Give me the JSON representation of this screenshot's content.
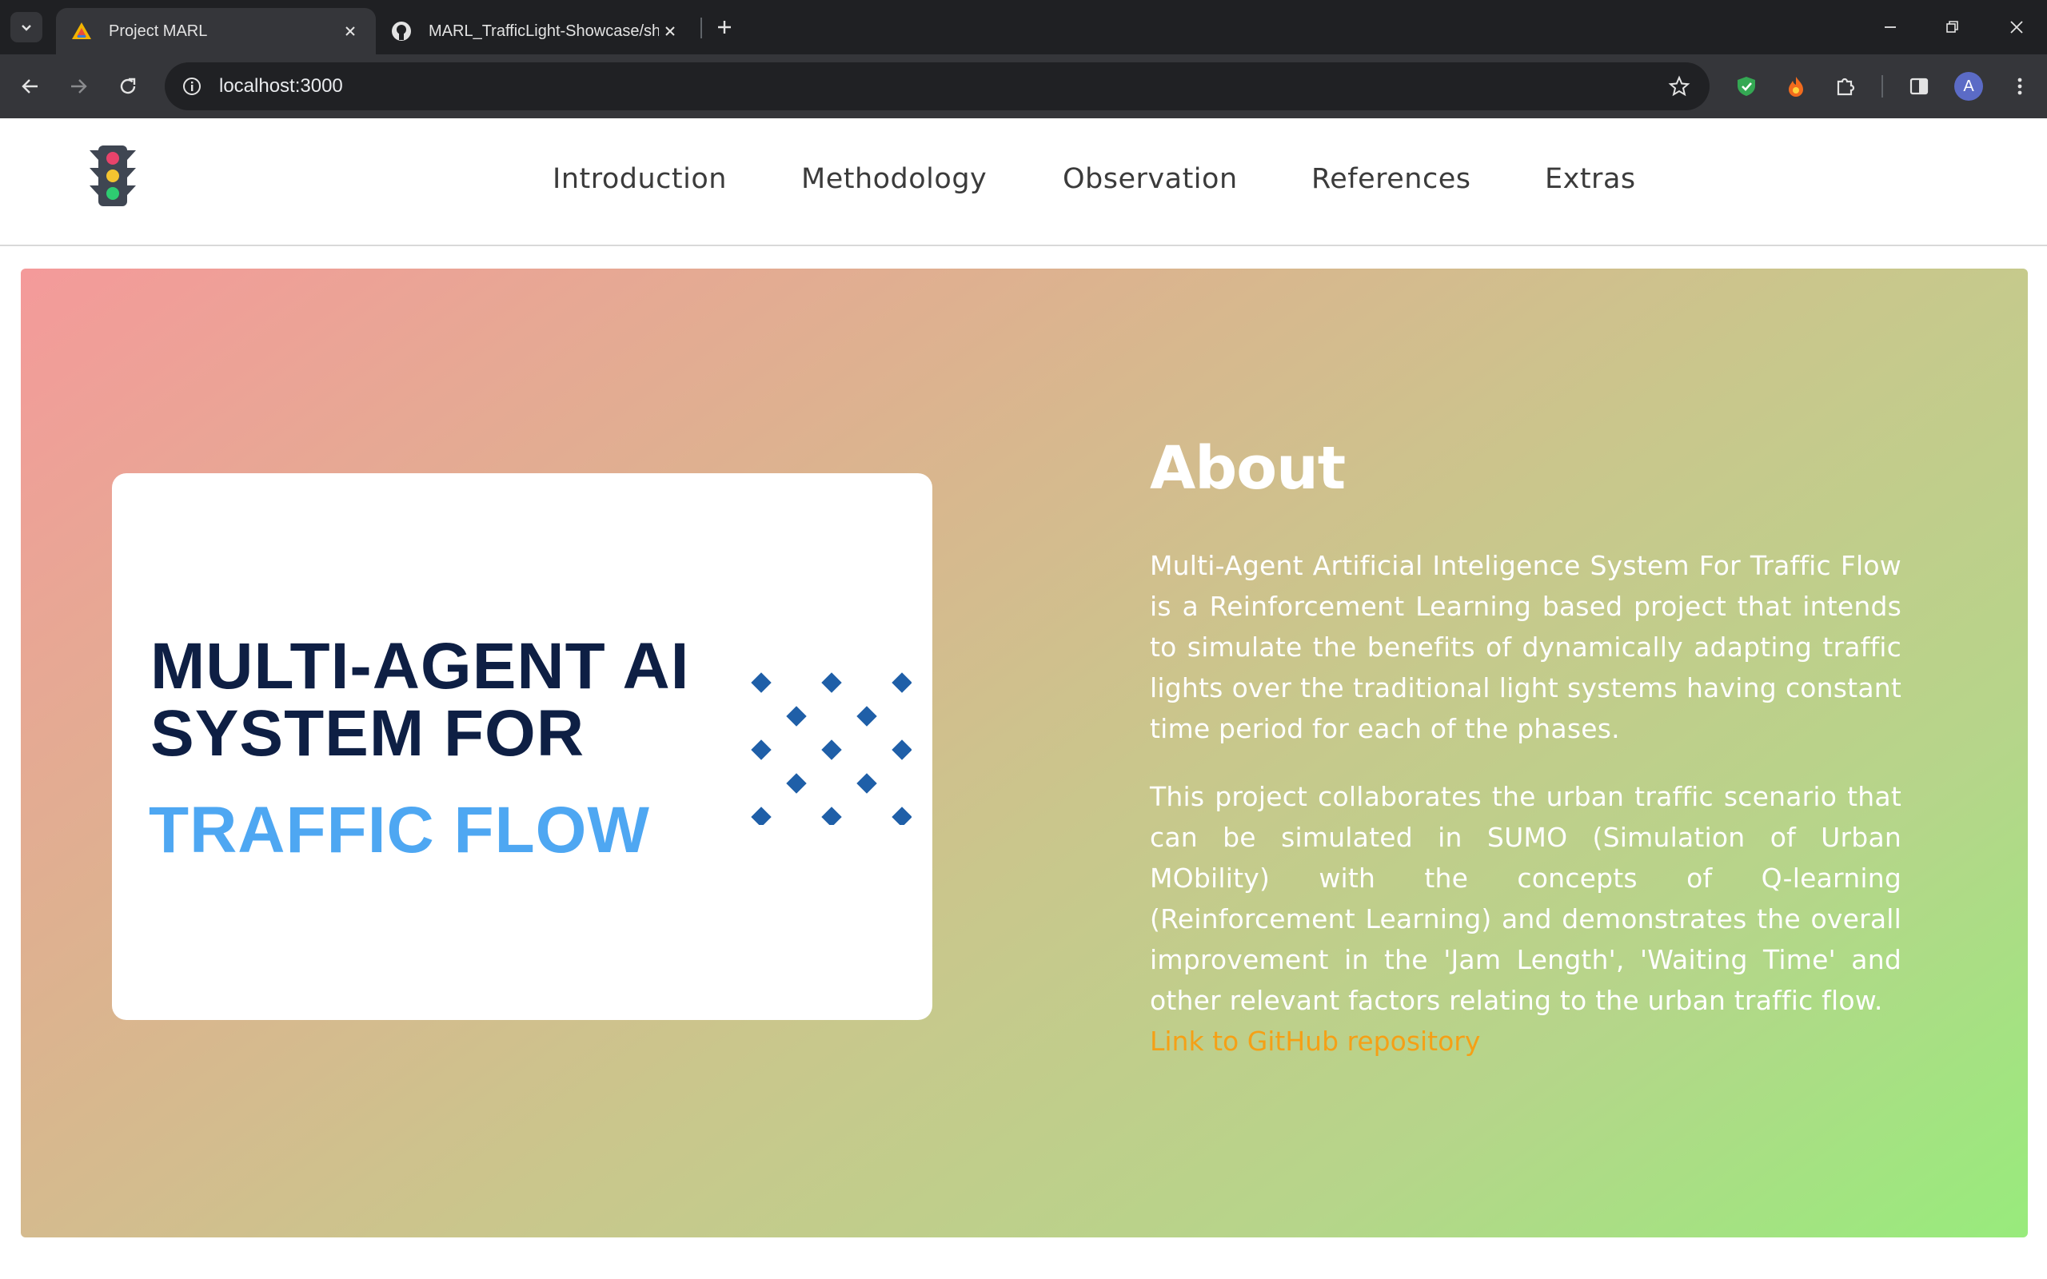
{
  "browser": {
    "tabs": [
      {
        "title": "Project MARL",
        "active": true,
        "favicon": "warning-triangle-icon"
      },
      {
        "title": "MARL_TrafficLight-Showcase/show",
        "active": false,
        "favicon": "github-icon"
      }
    ],
    "url": "localhost:3000",
    "profile_initial": "A"
  },
  "site": {
    "logo": "traffic-light-icon",
    "nav": [
      "Introduction",
      "Methodology",
      "Observation",
      "References",
      "Extras"
    ]
  },
  "hero": {
    "card": {
      "title_line1": "MULTI-AGENT AI",
      "title_line2": "SYSTEM FOR",
      "subtitle": "TRAFFIC FLOW"
    },
    "about": {
      "heading": "About",
      "paragraph1": "Multi-Agent Artificial Inteligence System For Traffic Flow is a Reinforcement Learning based project that intends to simulate the benefits of dynamically adapting traffic lights over the traditional light systems having constant time period for each of the phases.",
      "paragraph2": "This project collaborates the urban traffic scenario that can be simulated in SUMO (Simulation of Urban MObility) with the concepts of Q-learning (Reinforcement Learning) and demonstrates the overall improvement in the 'Jam Length', 'Waiting Time' and other relevant factors relating to the urban traffic flow.",
      "link_text": "Link to GitHub repository"
    }
  },
  "colors": {
    "card_title": "#0e1f44",
    "card_subtitle": "#4ea7f2",
    "link": "#f5a016",
    "gradient_start": "#f49a9a",
    "gradient_end": "#98eb7c"
  }
}
